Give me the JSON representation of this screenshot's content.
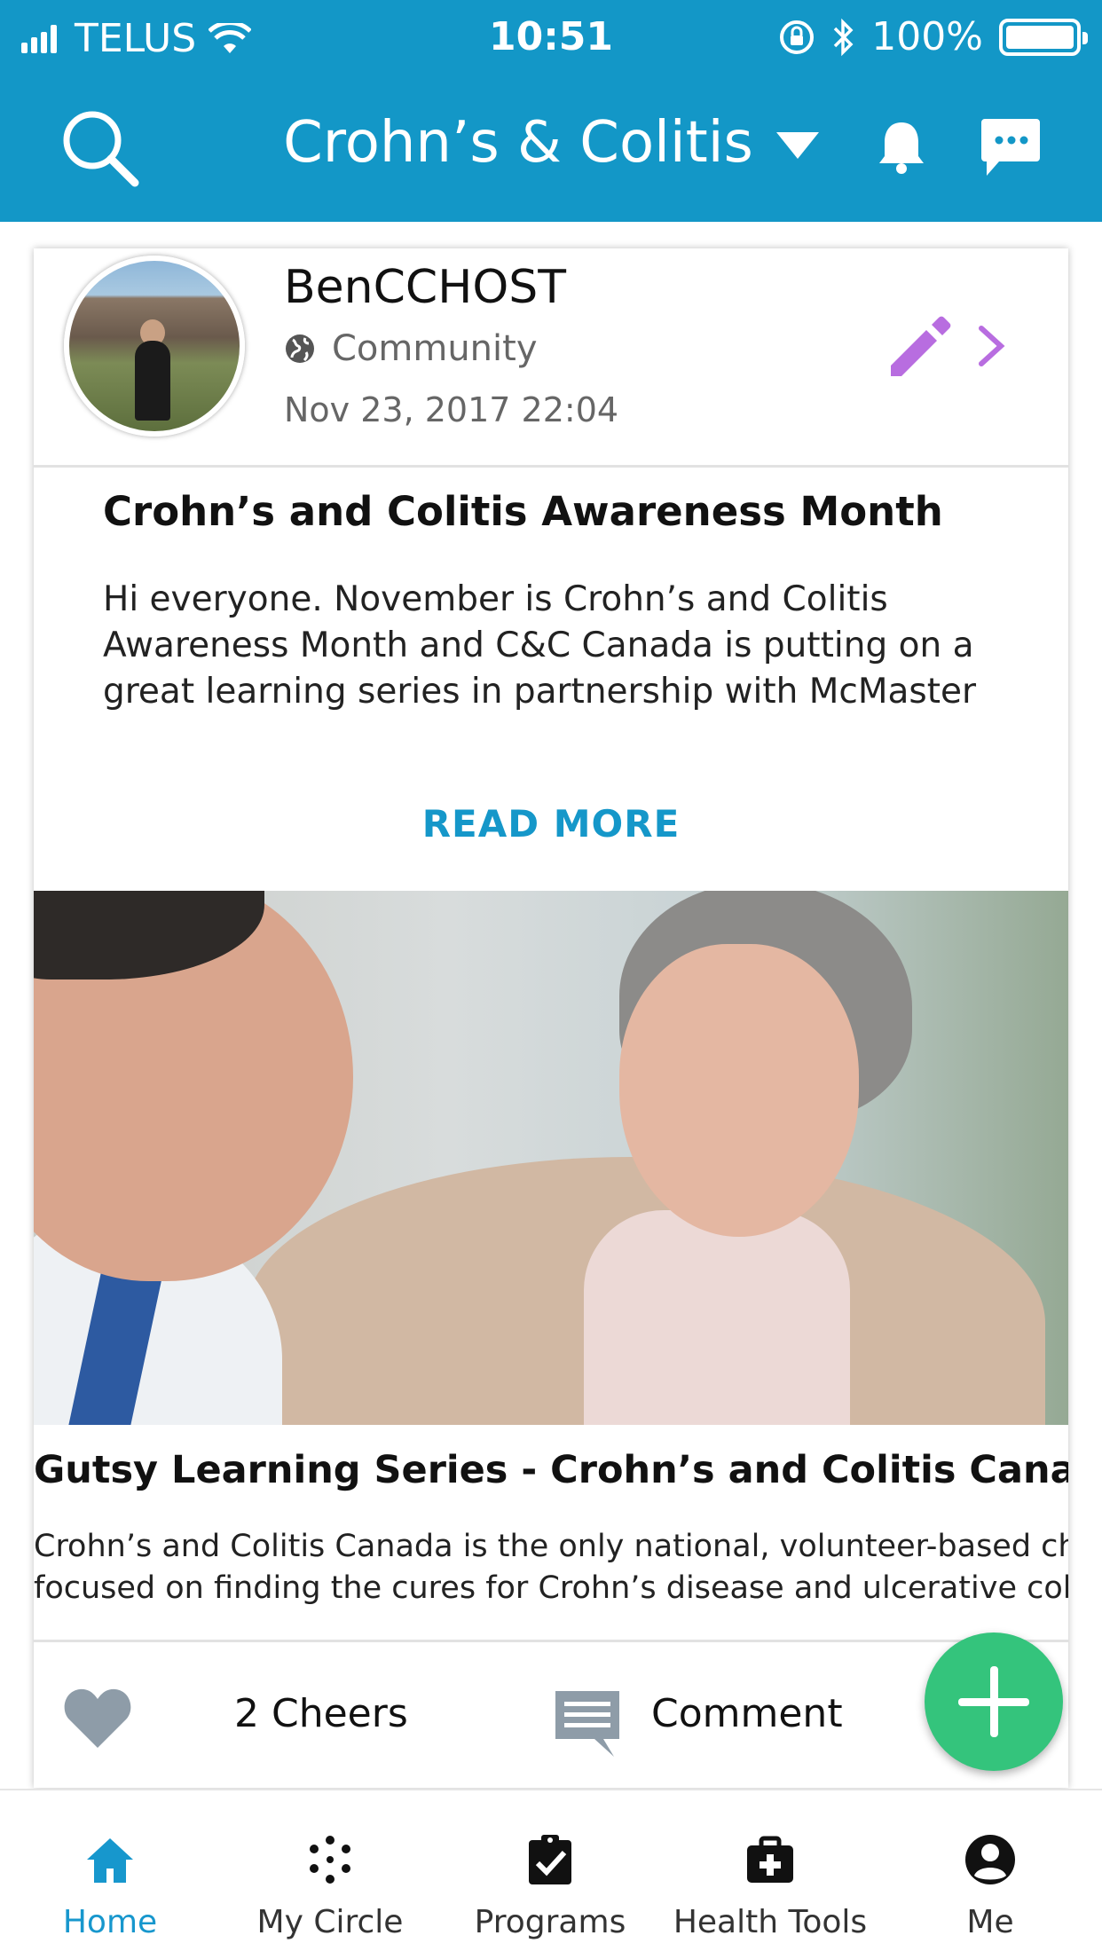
{
  "status_bar": {
    "carrier": "TELUS",
    "time": "10:51",
    "battery": "100%"
  },
  "header": {
    "community_title": "Crohn’s & Colitis"
  },
  "post": {
    "author": "BenCCHOST",
    "visibility": "Community",
    "timestamp": "Nov 23, 2017 22:04",
    "title": "Crohn’s and Colitis Awareness Month",
    "body_lines": [
      "Hi everyone. November is Crohn’s and Colitis",
      "Awareness Month and C&C Canada is putting on a",
      "great learning series in partnership with McMaster"
    ],
    "read_more": "READ MORE",
    "link_preview": {
      "title": "Gutsy Learning Series - Crohn’s and Colitis Canada",
      "description_lines": [
        "Crohn’s and Colitis Canada is the only national, volunteer-based charity",
        "focused on finding the cures for Crohn’s disease and ulcerative colitis..."
      ]
    },
    "cheers": "2 Cheers",
    "comment": "Comment"
  },
  "tabs": [
    {
      "label": "Home",
      "icon": "home-icon",
      "active": true
    },
    {
      "label": "My Circle",
      "icon": "circle-dots-icon",
      "active": false
    },
    {
      "label": "Programs",
      "icon": "clipboard-check-icon",
      "active": false
    },
    {
      "label": "Health Tools",
      "icon": "medical-kit-icon",
      "active": false
    },
    {
      "label": "Me",
      "icon": "account-icon",
      "active": false
    }
  ],
  "colors": {
    "header_blue": "#1397c7",
    "accent_purple": "#b86de0",
    "fab_green": "#34c47c",
    "active_tab_blue": "#1797cd"
  }
}
